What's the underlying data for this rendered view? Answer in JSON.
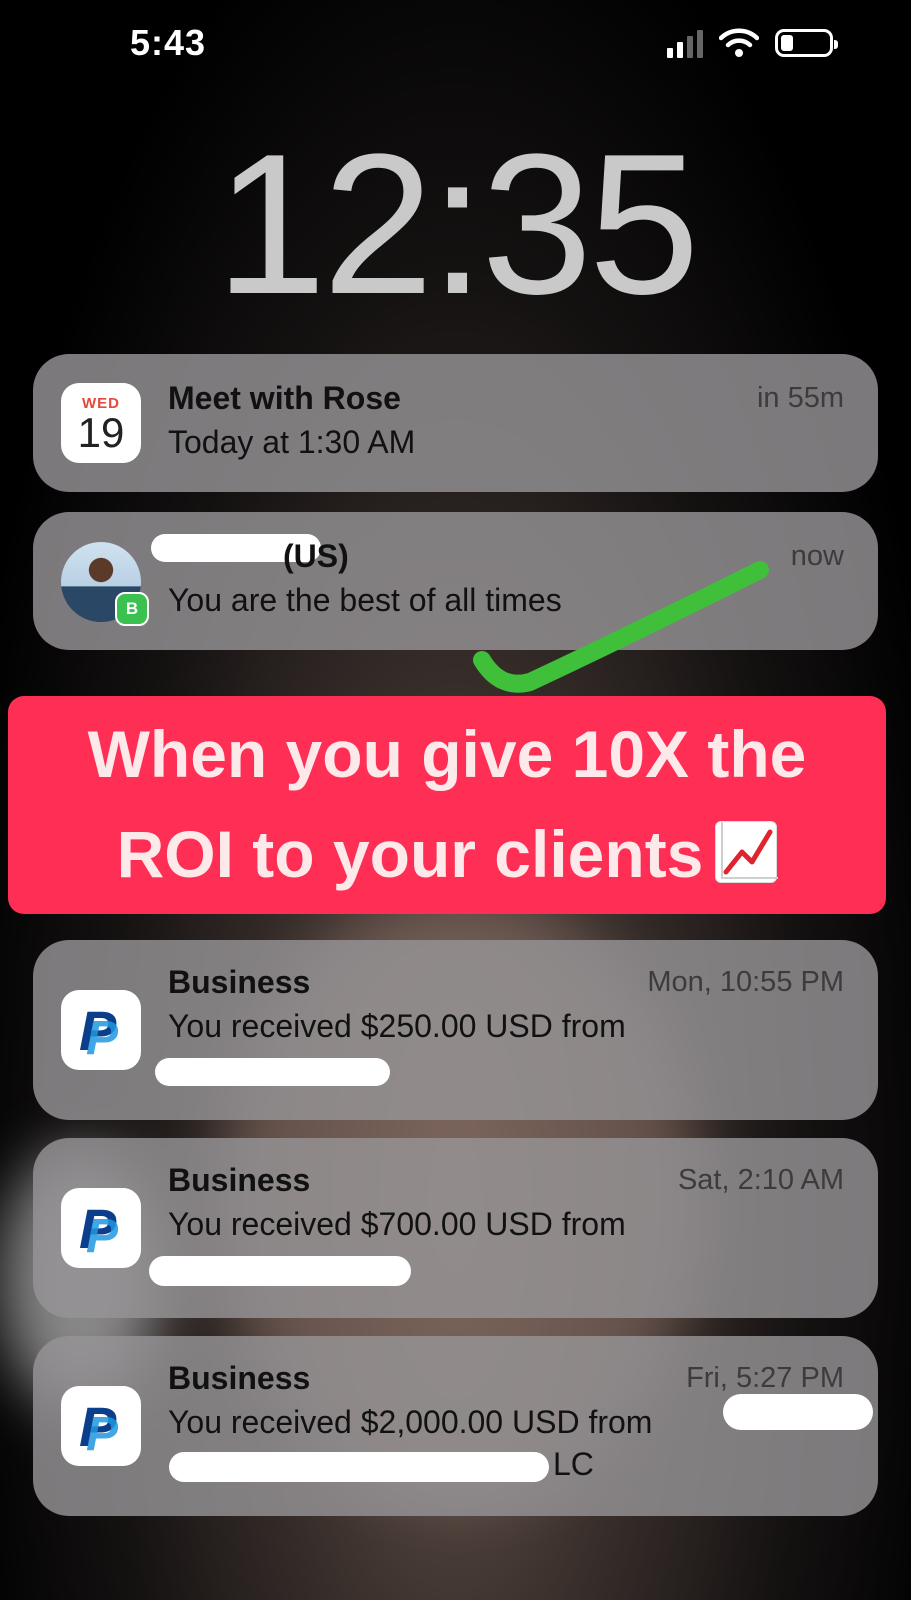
{
  "status_bar": {
    "time": "5:43"
  },
  "lock_screen": {
    "time": "12:35"
  },
  "notifications": [
    {
      "app": "calendar-icon",
      "weekday": "WED",
      "day": "19",
      "title": "Meet with Rose",
      "body": "Today at 1:30 AM",
      "time": "in 55m"
    },
    {
      "app": "whatsapp-icon",
      "title": "(US)",
      "body": "You are the best of all times",
      "time": "now"
    },
    {
      "app": "paypal-icon",
      "title": "Business",
      "body": "You received $250.00 USD from",
      "time": "Mon, 10:55 PM"
    },
    {
      "app": "paypal-icon",
      "title": "Business",
      "body": "You received $700.00 USD from",
      "time": "Sat, 2:10 AM"
    },
    {
      "app": "paypal-icon",
      "title": "Business",
      "body": "You received $2,000.00 USD from",
      "body2": "LC",
      "time": "Fri, 5:27 PM"
    }
  ],
  "overlay": {
    "line1": "When you give 10X the",
    "line2": "ROI to your clients",
    "emoji": "chart-increasing-icon"
  },
  "colors": {
    "banner": "#fe2e55",
    "checkmark": "#3fbf3a",
    "whatsapp": "#3ac14f"
  }
}
